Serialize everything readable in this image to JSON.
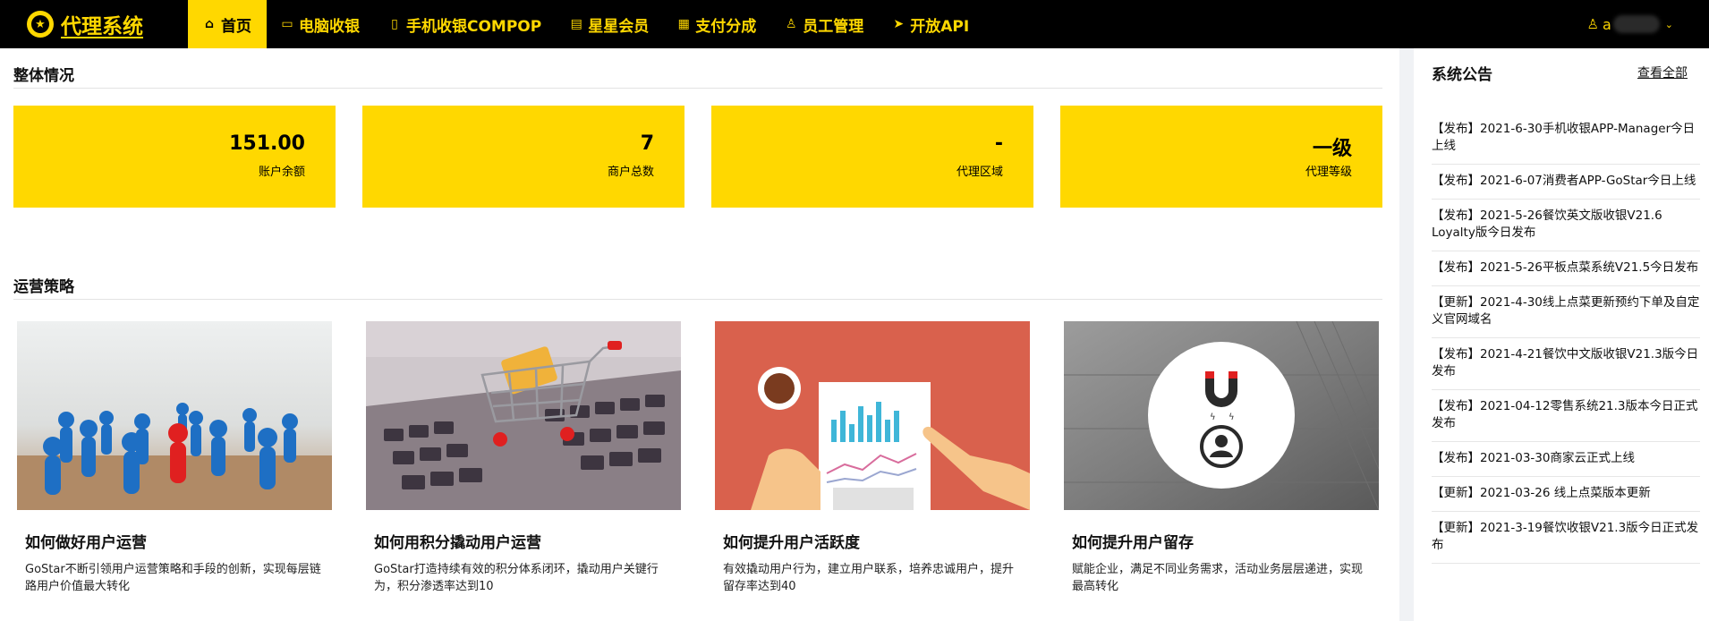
{
  "brand": {
    "title": "代理系统",
    "logo_icon": "star-icon"
  },
  "nav": [
    {
      "label": "首页",
      "icon": "home-icon",
      "glyph": "⌂",
      "active": true
    },
    {
      "label": "电脑收银",
      "icon": "monitor-icon",
      "glyph": "▭",
      "active": false
    },
    {
      "label": "手机收银COMPOP",
      "icon": "mobile-icon",
      "glyph": "▯",
      "active": false
    },
    {
      "label": "星星会员",
      "icon": "book-icon",
      "glyph": "▤",
      "active": false
    },
    {
      "label": "支付分成",
      "icon": "calculator-icon",
      "glyph": "▦",
      "active": false
    },
    {
      "label": "员工管理",
      "icon": "user-icon",
      "glyph": "♙",
      "active": false
    },
    {
      "label": "开放API",
      "icon": "send-icon",
      "glyph": "➤",
      "active": false
    }
  ],
  "user": {
    "icon": "user-icon",
    "name_visible": "a",
    "caret": "⌄"
  },
  "overview": {
    "title": "整体情况",
    "stats": [
      {
        "value": "151.00",
        "label": "账户余额"
      },
      {
        "value": "7",
        "label": "商户总数"
      },
      {
        "value": "-",
        "label": "代理区域"
      },
      {
        "value": "一级",
        "label": "代理等级"
      }
    ]
  },
  "strategy": {
    "title": "运营策略",
    "cards": [
      {
        "title": "如何做好用户运营",
        "desc": "GoStar不断引领用户运营策略和手段的创新，实现每层链路用户价值最大转化",
        "image": "pawns-image"
      },
      {
        "title": "如何用积分撬动用户运营",
        "desc": "GoStar打造持续有效的积分体系闭环，撬动用户关键行为，积分渗透率达到10",
        "image": "cart-keyboard-image"
      },
      {
        "title": "如何提升用户活跃度",
        "desc": "有效撬动用户行为，建立用户联系，培养忠诚用户，提升留存率达到40",
        "image": "chart-hands-image"
      },
      {
        "title": "如何提升用户留存",
        "desc": "赋能企业，满足不同业务需求，活动业务层层递进，实现最高转化",
        "image": "magnet-user-image"
      }
    ]
  },
  "announcements": {
    "title": "系统公告",
    "more_label": "查看全部",
    "items": [
      "【发布】2021-6-30手机收银APP-Manager今日上线",
      "【发布】2021-6-07消费者APP-GoStar今日上线",
      "【发布】2021-5-26餐饮英文版收银V21.6 Loyalty版今日发布",
      "【发布】2021-5-26平板点菜系统V21.5今日发布",
      "【更新】2021-4-30线上点菜更新预约下单及自定义官网域名",
      "【发布】2021-4-21餐饮中文版收银V21.3版今日发布",
      "【发布】2021-04-12零售系统21.3版本今日正式发布",
      "【发布】2021-03-30商家云正式上线",
      "【更新】2021-03-26 线上点菜版本更新",
      "【更新】2021-3-19餐饮收银V21.3版今日正式发布"
    ]
  },
  "colors": {
    "accent": "#ffd800",
    "nav_bg": "#000000"
  }
}
